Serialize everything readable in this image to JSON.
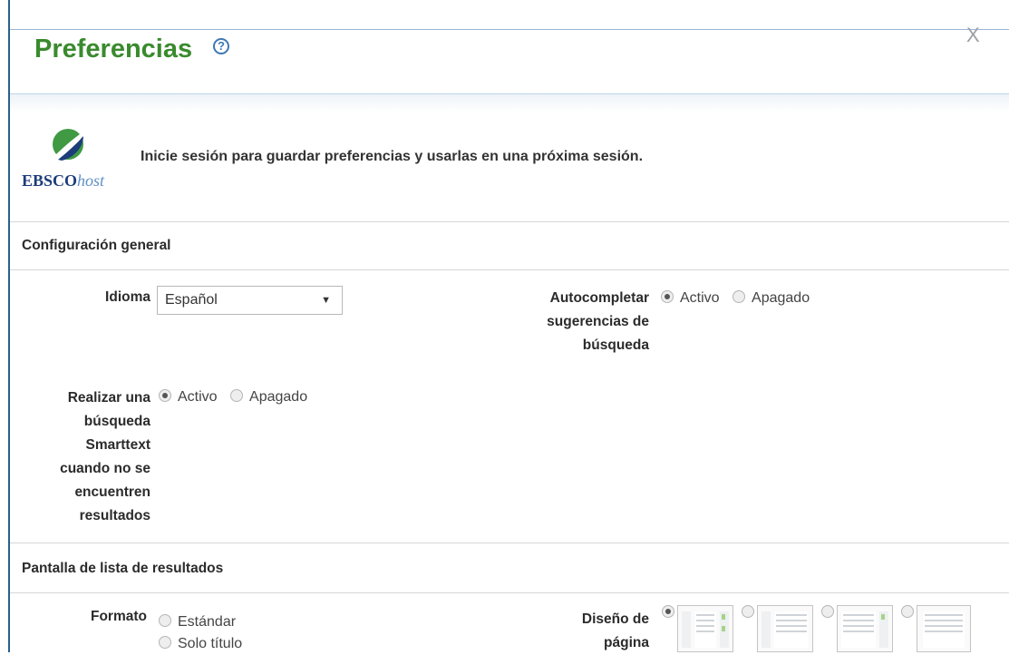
{
  "dialog": {
    "title": "Preferencias",
    "help_icon": "question-circle-icon",
    "close_label": "X"
  },
  "login": {
    "logo_brand": "EBSCO",
    "logo_suffix": "host",
    "message": "Inicie sesión para guardar preferencias y usarlas en una próxima sesión."
  },
  "general": {
    "section_title": "Configuración general",
    "language": {
      "label": "Idioma",
      "selected": "Español"
    },
    "autocomplete": {
      "label_lines": [
        "Autocompletar",
        "sugerencias de",
        "búsqueda"
      ],
      "options": [
        "Activo",
        "Apagado"
      ],
      "selected": "Activo"
    },
    "smarttext": {
      "label_lines": [
        "Realizar una",
        "búsqueda",
        "Smarttext",
        "cuando no se",
        "encuentren",
        "resultados"
      ],
      "options": [
        "Activo",
        "Apagado"
      ],
      "selected": "Activo"
    }
  },
  "results": {
    "section_title": "Pantalla de lista de resultados",
    "format": {
      "label": "Formato",
      "options": [
        "Estándar",
        "Solo título"
      ]
    },
    "page_layout": {
      "label_lines": [
        "Diseño de",
        "página"
      ],
      "option_count_visible": 4,
      "selected_index": 0
    }
  },
  "colors": {
    "title_green": "#3a8a2e",
    "accent_blue": "#2b5f8a",
    "logo_green": "#3f9a43"
  }
}
